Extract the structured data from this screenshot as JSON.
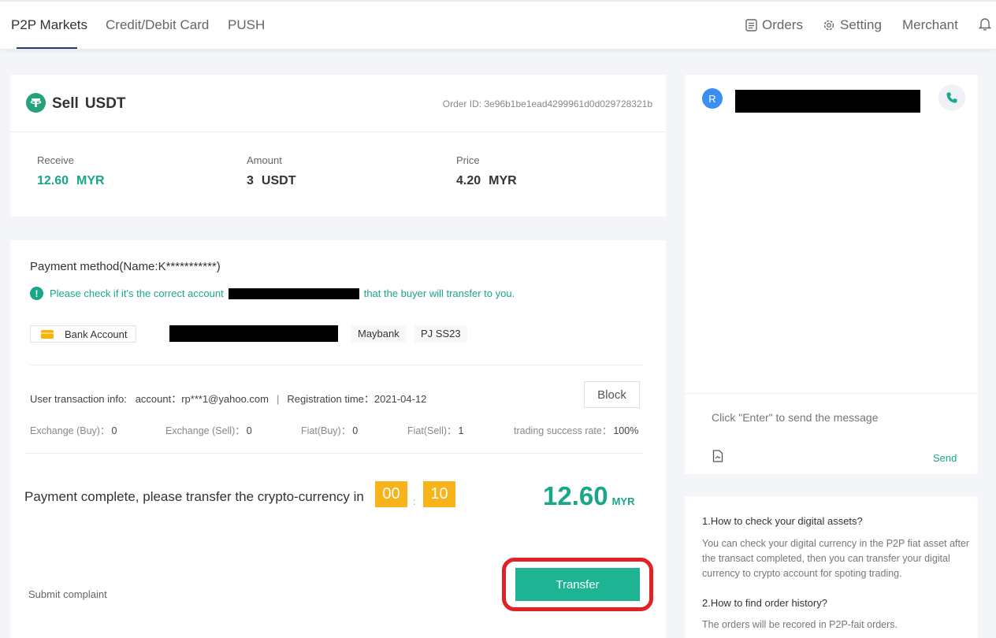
{
  "nav": {
    "tabs": [
      "P2P Markets",
      "Credit/Debit Card",
      "PUSH"
    ],
    "orders": "Orders",
    "setting": "Setting",
    "merchant": "Merchant"
  },
  "order": {
    "side": "Sell",
    "asset": "USDT",
    "order_id": "Order ID:  3e96b1be1ead4299961d0d029728321b",
    "receive_label": "Receive",
    "receive_value": "12.60",
    "receive_unit": "MYR",
    "amount_label": "Amount",
    "amount_value": "3",
    "amount_unit": "USDT",
    "price_label": "Price",
    "price_value": "4.20",
    "price_unit": "MYR"
  },
  "payment": {
    "method_title": "Payment method(Name:K***********)",
    "notice_pre": "Please check if it's the correct account",
    "notice_post": "that the buyer will transfer to you.",
    "bank_label": "Bank Account",
    "bank_name": "Maybank",
    "branch": "PJ SS23",
    "user_info_label": "User transaction info:",
    "account": "account：rp***1@yahoo.com",
    "registration": "Registration time：2021-04-12",
    "block_label": "Block",
    "stats": [
      {
        "label": "Exchange (Buy)：",
        "value": "0"
      },
      {
        "label": "Exchange (Sell)：",
        "value": "0"
      },
      {
        "label": "Fiat(Buy)：",
        "value": "0"
      },
      {
        "label": "Fiat(Sell)：",
        "value": "1"
      },
      {
        "label": "trading success rate：",
        "value": "100%"
      }
    ],
    "complete_text": "Payment complete, please transfer the crypto-currency in",
    "timer_min": "00",
    "timer_sec": "10",
    "timer_sep": ":",
    "total": "12.60",
    "total_unit": "MYR",
    "submit_complaint": "Submit complaint",
    "transfer_label": "Transfer"
  },
  "chat": {
    "avatar_letter": "R",
    "placeholder": "Click \"Enter\" to send the message",
    "send_label": "Send"
  },
  "faq": [
    {
      "q": "1.How to check your digital assets?",
      "a": "You can check your digital currency in the P2P fiat asset after the transact completed, then you can transfer your digital currency to crypto account for spoting trading."
    },
    {
      "q": "2.How to find order history?",
      "a": "The orders will be recored in P2P-fait orders."
    }
  ],
  "colors": {
    "accent": "#1aa68a",
    "timer": "#f7b319",
    "highlight": "#e02127"
  }
}
